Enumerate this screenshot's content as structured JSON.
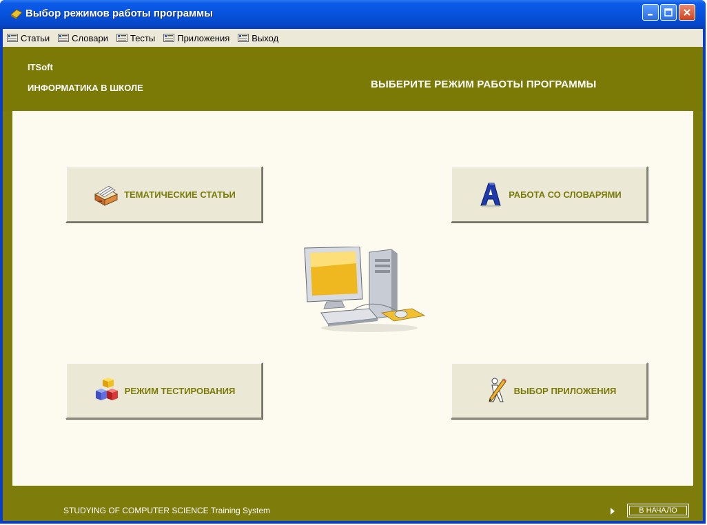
{
  "window": {
    "title": "Выбор режимов работы программы"
  },
  "menu": {
    "items": [
      {
        "label": "Статьи"
      },
      {
        "label": "Словари"
      },
      {
        "label": "Тесты"
      },
      {
        "label": "Приложения"
      },
      {
        "label": "Выход"
      }
    ]
  },
  "header": {
    "brand": "ITSoft",
    "subtitle": "ИНФОРМАТИКА В ШКОЛЕ",
    "title": "ВЫБЕРИТЕ РЕЖИМ РАБОТЫ ПРОГРАММЫ"
  },
  "modes": {
    "articles": {
      "label": "ТЕМАТИЧЕСКИЕ СТАТЬИ",
      "icon": "card-file-icon"
    },
    "dictionaries": {
      "label": "РАБОТА СО СЛОВАРЯМИ",
      "icon": "letter-a-icon"
    },
    "testing": {
      "label": "РЕЖИМ ТЕСТИРОВАНИЯ",
      "icon": "cubes-icon"
    },
    "apps": {
      "label": "ВЫБОР ПРИЛОЖЕНИЯ",
      "icon": "pencil-figure-icon"
    }
  },
  "footer": {
    "text": "STUDYING OF COMPUTER SCIENCE Training System",
    "home_label": "В НАЧАЛО"
  },
  "colors": {
    "olive": "#7b7a06",
    "content_bg": "#fdfaf0",
    "button_face": "#ece8d6",
    "xp_blue": "#0652dc"
  }
}
